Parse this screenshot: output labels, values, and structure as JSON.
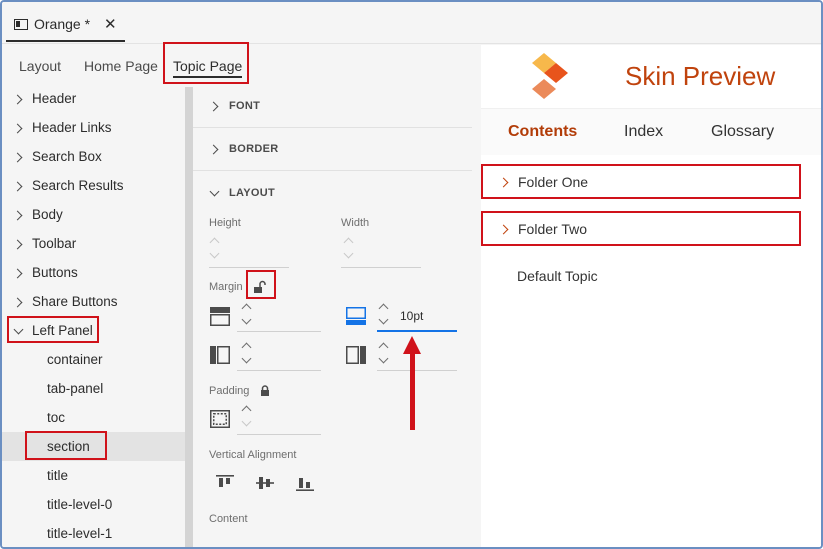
{
  "document_tab": {
    "title": "Orange *",
    "close": "✕"
  },
  "sub_tabs": [
    "Layout",
    "Home Page",
    "Topic Page"
  ],
  "tree": {
    "items": [
      "Header",
      "Header Links",
      "Search Box",
      "Search Results",
      "Body",
      "Toolbar",
      "Buttons",
      "Share Buttons",
      "Left Panel"
    ],
    "children": [
      "container",
      "tab-panel",
      "toc",
      "section",
      "title",
      "title-level-0",
      "title-level-1"
    ],
    "expanded_item": "Left Panel",
    "selected_child": "section"
  },
  "properties": {
    "sections": [
      "FONT",
      "BORDER",
      "LAYOUT"
    ],
    "height_label": "Height",
    "width_label": "Width",
    "margin_label": "Margin",
    "margin_bottom_value": "10pt",
    "padding_label": "Padding",
    "vertical_alignment_label": "Vertical Alignment",
    "content_label": "Content"
  },
  "preview": {
    "title": "Skin Preview",
    "tabs": [
      "Contents",
      "Index",
      "Glossary"
    ],
    "active_tab": "Contents",
    "folders": [
      "Folder One",
      "Folder Two"
    ],
    "topic": "Default Topic"
  },
  "colors": {
    "accent": "#c0430d",
    "highlight": "#d0121a",
    "focus_blue": "#1473e6",
    "logo_orange": "#e8541c",
    "logo_yellow": "#f7b84b",
    "logo_peach": "#eb8a5a"
  }
}
